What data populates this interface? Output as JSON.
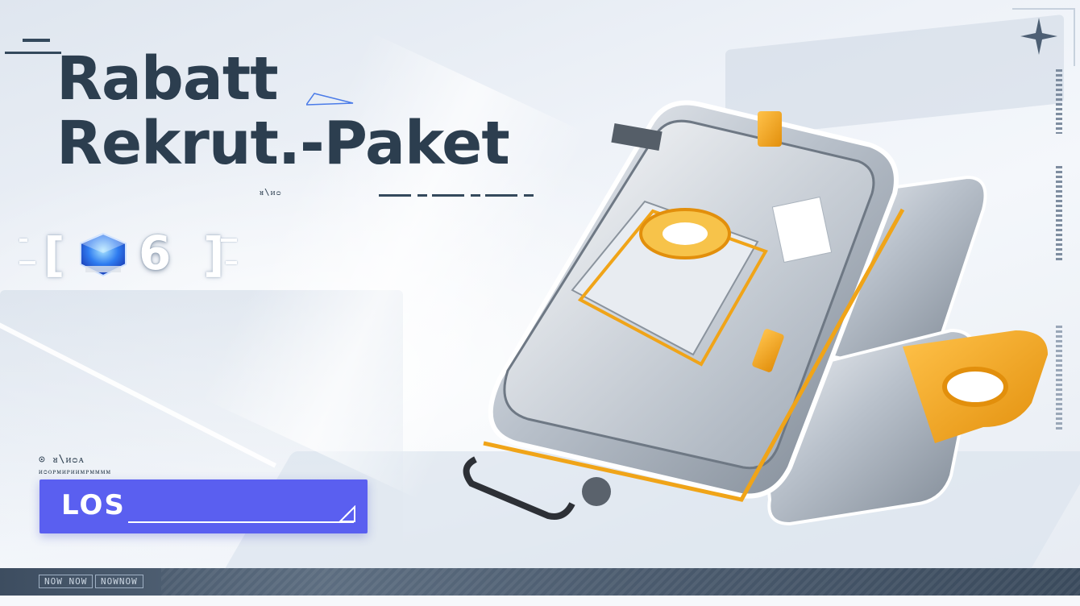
{
  "banner": {
    "title_line1": "Rabatt",
    "title_line2": "Rekrut.-Paket",
    "title_tag": "ᴚ\\ᴎᴑ",
    "count": "6",
    "small_tag1": "⊙ ᴚ\\ᴎᴑᴀ",
    "small_tag2": "ᴎᴑᴏᴘᴍᴎᴘᴎᴎᴍᴘᴍᴍᴍᴍ",
    "button_label": "LOS",
    "bottom_tag1": "NOW NOW",
    "bottom_tag2": "NOWNOW"
  },
  "colors": {
    "accent_button": "#5a5ff0",
    "title": "#2c3e4f",
    "case_orange": "#f0a418",
    "bottom_bar": "#4a5a6d"
  },
  "icons": [
    "sparkle-icon",
    "blue-crystal-icon",
    "triangle-corner-icon"
  ]
}
